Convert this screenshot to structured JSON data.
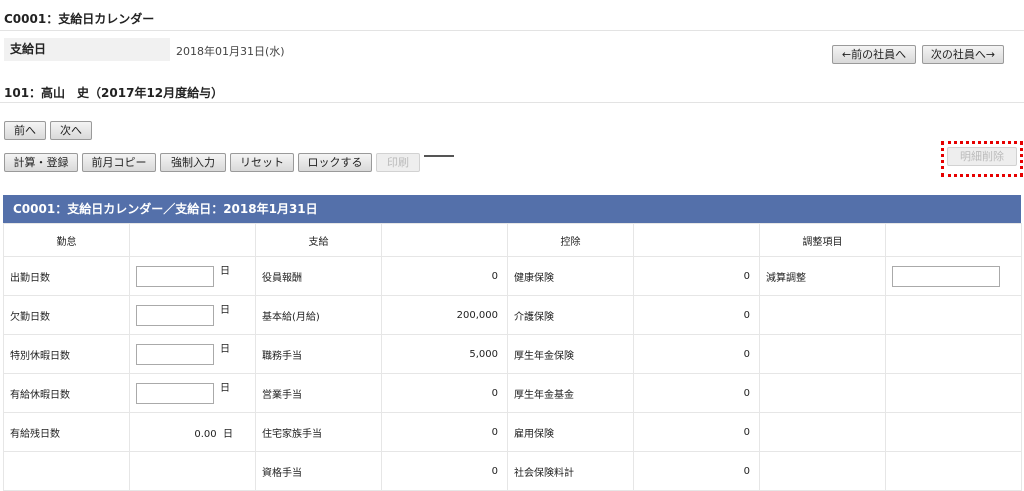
{
  "header": {
    "title": "C0001：支給日カレンダー"
  },
  "payday": {
    "label": "支給日",
    "value": "2018年01月31日(水)"
  },
  "nav": {
    "prev_employee": "←前の社員へ",
    "next_employee": "次の社員へ→"
  },
  "employee": {
    "heading": "101：高山　史（2017年12月度給与）"
  },
  "pager": {
    "prev": "前へ",
    "next": "次へ"
  },
  "actions": {
    "calc_register": "計算・登録",
    "copy_prev_month": "前月コピー",
    "force_input": "強制入力",
    "reset": "リセット",
    "lock": "ロックする",
    "print": "印刷",
    "delete_detail": "明細削除"
  },
  "banner": {
    "text": "C0001：支給日カレンダー／支給日：2018年1月31日"
  },
  "columns": {
    "attendance": "勤怠",
    "payment": "支給",
    "deduction": "控除",
    "adjustment": "調整項目"
  },
  "rows": [
    {
      "att_label": "出勤日数",
      "att_unit": "日",
      "pay_label": "役員報酬",
      "pay_value": "0",
      "ded_label": "健康保険",
      "ded_value": "0",
      "adj_label": "減算調整"
    },
    {
      "att_label": "欠勤日数",
      "att_unit": "日",
      "pay_label": "基本給(月給)",
      "pay_value": "200,000",
      "ded_label": "介護保険",
      "ded_value": "0",
      "adj_label": ""
    },
    {
      "att_label": "特別休暇日数",
      "att_unit": "日",
      "pay_label": "職務手当",
      "pay_value": "5,000",
      "ded_label": "厚生年金保険",
      "ded_value": "0",
      "adj_label": ""
    },
    {
      "att_label": "有給休暇日数",
      "att_unit": "日",
      "pay_label": "営業手当",
      "pay_value": "0",
      "ded_label": "厚生年金基金",
      "ded_value": "0",
      "adj_label": ""
    },
    {
      "att_label": "有給残日数",
      "att_value": "0.00",
      "att_unit": "日",
      "pay_label": "住宅家族手当",
      "pay_value": "0",
      "ded_label": "雇用保険",
      "ded_value": "0",
      "adj_label": ""
    },
    {
      "att_label": "",
      "pay_label": "資格手当",
      "pay_value": "0",
      "ded_label": "社会保険料計",
      "ded_value": "0",
      "adj_label": ""
    }
  ]
}
